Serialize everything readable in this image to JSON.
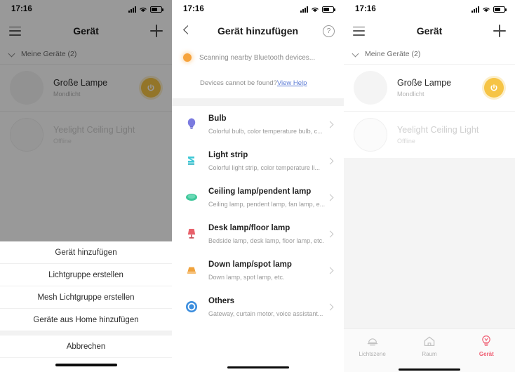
{
  "status_bar": {
    "time": "17:16",
    "icons": [
      "signal-icon",
      "wifi-icon",
      "battery-icon"
    ]
  },
  "panel1": {
    "nav": {
      "menu_icon": "hamburger-icon",
      "title": "Gerät",
      "add_icon": "plus-icon"
    },
    "group": {
      "label": "Meine Geräte (2)",
      "chevron": "chevron-down-icon"
    },
    "devices": [
      {
        "name": "Große Lampe",
        "status": "Mondlicht",
        "power": "on"
      },
      {
        "name": "Yeelight Ceiling Light",
        "status": "Offline",
        "power": "off"
      }
    ],
    "action_sheet": {
      "items": [
        "Gerät hinzufügen",
        "Lichtgruppe erstellen",
        "Mesh Lichtgruppe erstellen",
        "Geräte aus Home hinzufügen"
      ],
      "cancel": "Abbrechen"
    }
  },
  "panel2": {
    "nav": {
      "back_icon": "chevron-left-icon",
      "title": "Gerät hinzufügen",
      "help_icon": "question-mark-icon"
    },
    "scan": {
      "text": "Scanning nearby Bluetooth devices...",
      "not_found_text": "Devices cannot be found?",
      "help_link": "View Help"
    },
    "categories": [
      {
        "icon": "bulb-icon",
        "color": "#7b7be0",
        "title": "Bulb",
        "desc": "Colorful bulb, color temperature bulb, c..."
      },
      {
        "icon": "light-strip-icon",
        "color": "#3fc8d6",
        "title": "Light strip",
        "desc": "Colorful light strip, color temperature li..."
      },
      {
        "icon": "ceiling-lamp-icon",
        "color": "#3fc79a",
        "title": "Ceiling lamp/pendent lamp",
        "desc": "Ceiling lamp, pendent lamp, fan lamp, e..."
      },
      {
        "icon": "desk-lamp-icon",
        "color": "#e8606a",
        "title": "Desk lamp/floor lamp",
        "desc": "Bedside lamp, desk lamp, floor lamp, etc."
      },
      {
        "icon": "down-lamp-icon",
        "color": "#f0a23c",
        "title": "Down lamp/spot lamp",
        "desc": "Down lamp, spot lamp, etc."
      },
      {
        "icon": "others-icon",
        "color": "#3c8ede",
        "title": "Others",
        "desc": "Gateway, curtain motor, voice assistant..."
      }
    ]
  },
  "panel3": {
    "nav": {
      "menu_icon": "hamburger-icon",
      "title": "Gerät",
      "add_icon": "plus-icon"
    },
    "group": {
      "label": "Meine Geräte (2)",
      "chevron": "chevron-down-icon"
    },
    "devices": [
      {
        "name": "Große Lampe",
        "status": "Mondlicht",
        "power": "on"
      },
      {
        "name": "Yeelight Ceiling Light",
        "status": "Offline",
        "power": "off"
      }
    ],
    "tabs": [
      {
        "label": "Lichtszene",
        "icon": "scene-icon",
        "active": false
      },
      {
        "label": "Raum",
        "icon": "home-icon",
        "active": false
      },
      {
        "label": "Gerät",
        "icon": "bulb-outline-icon",
        "active": true
      }
    ]
  },
  "colors": {
    "accent": "#ef5d72",
    "power_on": "#f6c445",
    "link": "#5b7bd5",
    "scan_dot": "#f6a33c"
  }
}
